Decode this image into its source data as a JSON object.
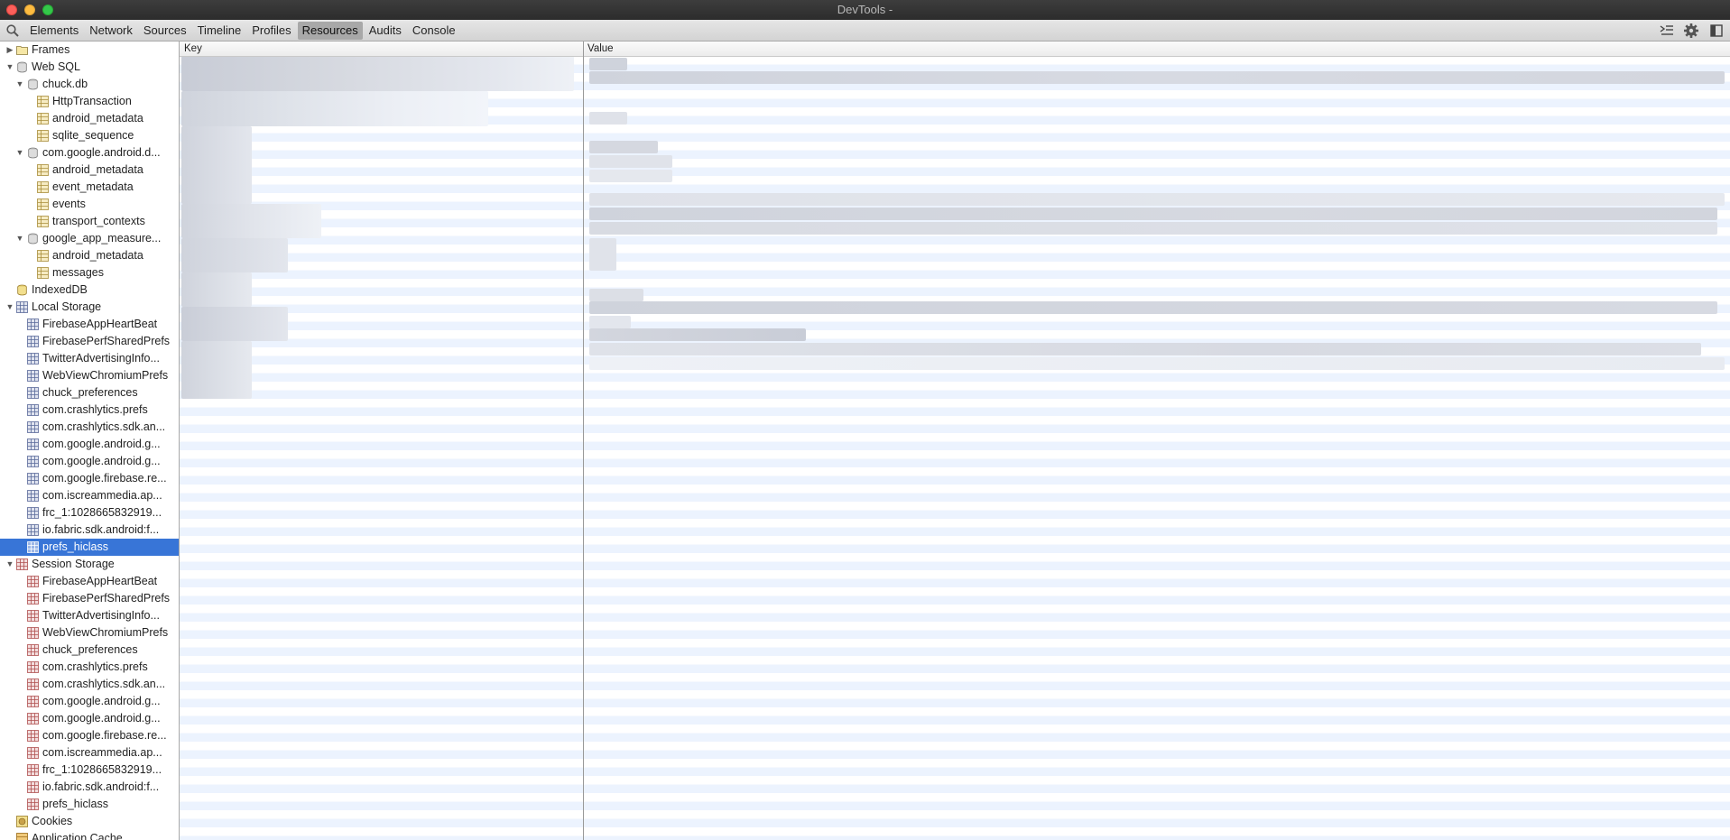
{
  "window": {
    "title": "DevTools -"
  },
  "toolbar": {
    "tabs": [
      {
        "label": "Elements"
      },
      {
        "label": "Network"
      },
      {
        "label": "Sources"
      },
      {
        "label": "Timeline"
      },
      {
        "label": "Profiles"
      },
      {
        "label": "Resources"
      },
      {
        "label": "Audits"
      },
      {
        "label": "Console"
      }
    ],
    "active_tab": "Resources"
  },
  "sidebar": {
    "frames": "Frames",
    "web_sql": {
      "label": "Web SQL",
      "databases": [
        {
          "label": "chuck.db",
          "tables": [
            "HttpTransaction",
            "android_metadata",
            "sqlite_sequence"
          ]
        },
        {
          "label": "com.google.android.d...",
          "tables": [
            "android_metadata",
            "event_metadata",
            "events",
            "transport_contexts"
          ]
        },
        {
          "label": "google_app_measure...",
          "tables": [
            "android_metadata",
            "messages"
          ]
        }
      ]
    },
    "indexeddb": "IndexedDB",
    "local_storage": {
      "label": "Local Storage",
      "items": [
        "FirebaseAppHeartBeat",
        "FirebasePerfSharedPrefs",
        "TwitterAdvertisingInfo...",
        "WebViewChromiumPrefs",
        "chuck_preferences",
        "com.crashlytics.prefs",
        "com.crashlytics.sdk.an...",
        "com.google.android.g...",
        "com.google.android.g...",
        "com.google.firebase.re...",
        "com.iscreammedia.ap...",
        "frc_1:1028665832919...",
        "io.fabric.sdk.android:f...",
        "prefs_hiclass"
      ],
      "selected": "prefs_hiclass"
    },
    "session_storage": {
      "label": "Session Storage",
      "items": [
        "FirebaseAppHeartBeat",
        "FirebasePerfSharedPrefs",
        "TwitterAdvertisingInfo...",
        "WebViewChromiumPrefs",
        "chuck_preferences",
        "com.crashlytics.prefs",
        "com.crashlytics.sdk.an...",
        "com.google.android.g...",
        "com.google.android.g...",
        "com.google.firebase.re...",
        "com.iscreammedia.ap...",
        "frc_1:1028665832919...",
        "io.fabric.sdk.android:f...",
        "prefs_hiclass"
      ]
    },
    "cookies": "Cookies",
    "application_cache": "Application Cache"
  },
  "grid": {
    "key_header": "Key",
    "value_header": "Value"
  },
  "colors": {
    "selection": "#3875d7",
    "row_stripe": "#ecf3fe",
    "local_storage_icon": "#5a6a9a",
    "session_storage_icon": "#b05050"
  }
}
